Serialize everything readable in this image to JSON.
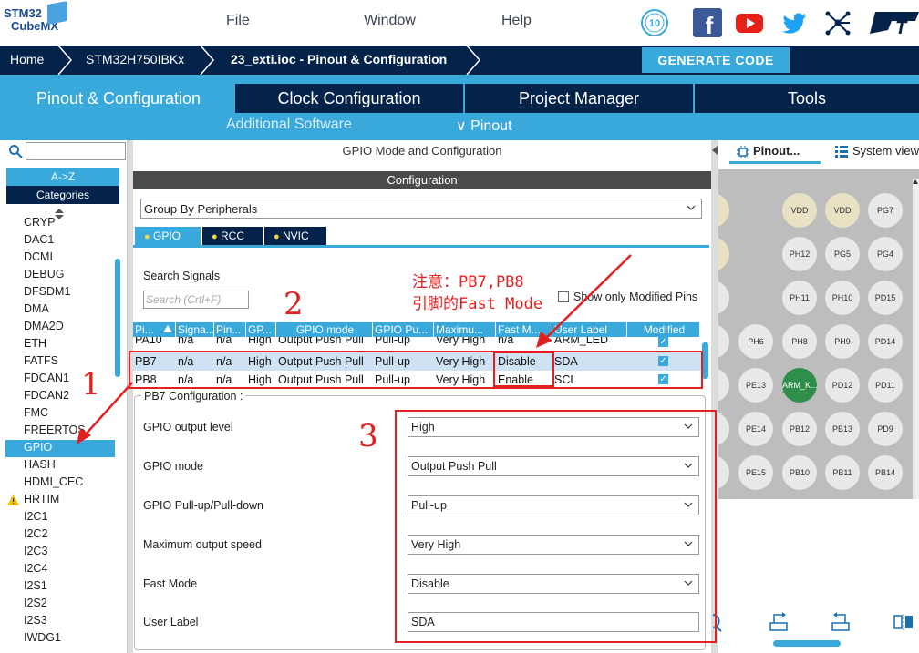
{
  "logo": {
    "line1": "STM32",
    "line2": "CubeMX"
  },
  "menu": {
    "file": "File",
    "window": "Window",
    "help": "Help"
  },
  "breadcrumb": {
    "home": "Home",
    "mcu": "STM32H750IBKx",
    "project": "23_exti.ioc - Pinout & Configuration"
  },
  "generate_button": "GENERATE CODE",
  "tabs": {
    "pinout": "Pinout & Configuration",
    "clock": "Clock Configuration",
    "project": "Project Manager",
    "tools": "Tools",
    "additional": "Additional Software",
    "pinout_menu": "∨ Pinout"
  },
  "sidebar": {
    "az": "A->Z",
    "categories": "Categories",
    "items": [
      "CRYP",
      "DAC1",
      "DCMI",
      "DEBUG",
      "DFSDM1",
      "DMA",
      "DMA2D",
      "ETH",
      "FATFS",
      "FDCAN1",
      "FDCAN2",
      "FMC",
      "FREERTOS",
      "GPIO",
      "HASH",
      "HDMI_CEC",
      "HRTIM",
      "I2C1",
      "I2C2",
      "I2C3",
      "I2C4",
      "I2S1",
      "I2S2",
      "I2S3",
      "IWDG1"
    ]
  },
  "middle": {
    "title": "GPIO Mode and Configuration",
    "config_bar": "Configuration",
    "group_select": "Group By Peripherals",
    "inner_tabs": [
      "GPIO",
      "RCC",
      "NVIC"
    ],
    "search_label": "Search Signals",
    "search_placeholder": "Search (Crtl+F)",
    "show_modified": "Show only Modified Pins"
  },
  "table": {
    "headers": [
      "Pi...",
      "Signa...",
      "Pin...",
      "GP...",
      "GPIO mode",
      "GPIO Pu...",
      "Maximu...",
      "Fast M...",
      "User Label",
      "Modified"
    ],
    "rows": [
      [
        "PA10",
        "n/a",
        "n/a",
        "High",
        "Output Push Pull",
        "Pull-up",
        "Very High",
        "n/a",
        "ARM_LED"
      ],
      [
        "PB7",
        "n/a",
        "n/a",
        "High",
        "Output Push Pull",
        "Pull-up",
        "Very High",
        "Disable",
        "SDA"
      ],
      [
        "PB8",
        "n/a",
        "n/a",
        "High",
        "Output Push Pull",
        "Pull-up",
        "Very High",
        "Enable",
        "SCL"
      ]
    ]
  },
  "pb7_config": {
    "title": "PB7 Configuration :",
    "fields": [
      {
        "label": "GPIO output level",
        "value": "High"
      },
      {
        "label": "GPIO mode",
        "value": "Output Push Pull"
      },
      {
        "label": "GPIO Pull-up/Pull-down",
        "value": "Pull-up"
      },
      {
        "label": "Maximum output speed",
        "value": "Very High"
      },
      {
        "label": "Fast Mode",
        "value": "Disable"
      },
      {
        "label": "User Label",
        "value": "SDA"
      }
    ]
  },
  "annotations": {
    "n1": "1",
    "n2": "2",
    "n3": "3",
    "note_line1": "注意：PB7,PB8",
    "note_line2": "引脚的Fast Mode"
  },
  "right": {
    "tab_pinout": "Pinout...",
    "tab_system": "System view",
    "pins": [
      "VDD",
      "VDD",
      "PG7",
      "PH12",
      "PG5",
      "PG4",
      "PH11",
      "PH10",
      "PD15",
      "PH6",
      "PH8",
      "PH9",
      "PD14",
      "PE13",
      "ARM_K...",
      "PD12",
      "PD11",
      "PE14",
      "PB12",
      "PB13",
      "PD9",
      "PE15",
      "PB10",
      "PB11",
      "PB14"
    ]
  },
  "colors": {
    "accent": "#39a9db",
    "navy": "#03234b",
    "annotation": "#e32020"
  }
}
